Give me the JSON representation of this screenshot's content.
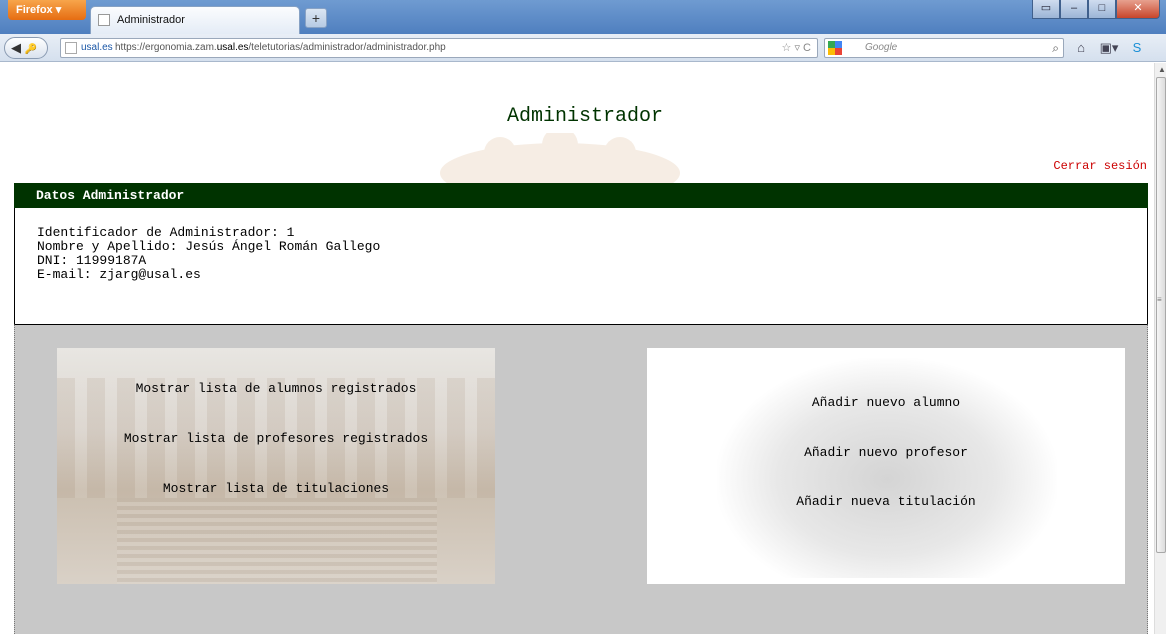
{
  "browser": {
    "app_button": "Firefox",
    "tab_title": "Administrador",
    "new_tab": "+",
    "url_domain": "usal.es",
    "url_prefix": "https://ergonomia.zam.",
    "url_bold": "usal.es",
    "url_suffix": "/teletutorias/administrador/administrador.php",
    "search_placeholder": "Google",
    "icons": [
      "back-icon",
      "forward-icon",
      "bookmark-star-icon",
      "reload-icon",
      "search-icon",
      "home-icon",
      "bookmarks-menu-icon",
      "skype-icon"
    ]
  },
  "page": {
    "title": "Administrador",
    "logout_link": "Cerrar sesión",
    "data_section": {
      "header": "Datos Administrador",
      "lines": [
        "Identificador de Administrador: 1",
        "Nombre y Apellido: Jesús Ángel Román Gallego",
        "DNI: 11999187A",
        "E-mail: zjarg@usal.es"
      ]
    },
    "left_panel": {
      "links": [
        "Mostrar lista de alumnos registrados",
        "Mostrar lista de profesores registrados",
        "Mostrar lista de titulaciones"
      ]
    },
    "right_panel": {
      "links": [
        "Añadir nuevo alumno",
        "Añadir nuevo profesor",
        "Añadir nueva titulación"
      ]
    }
  }
}
